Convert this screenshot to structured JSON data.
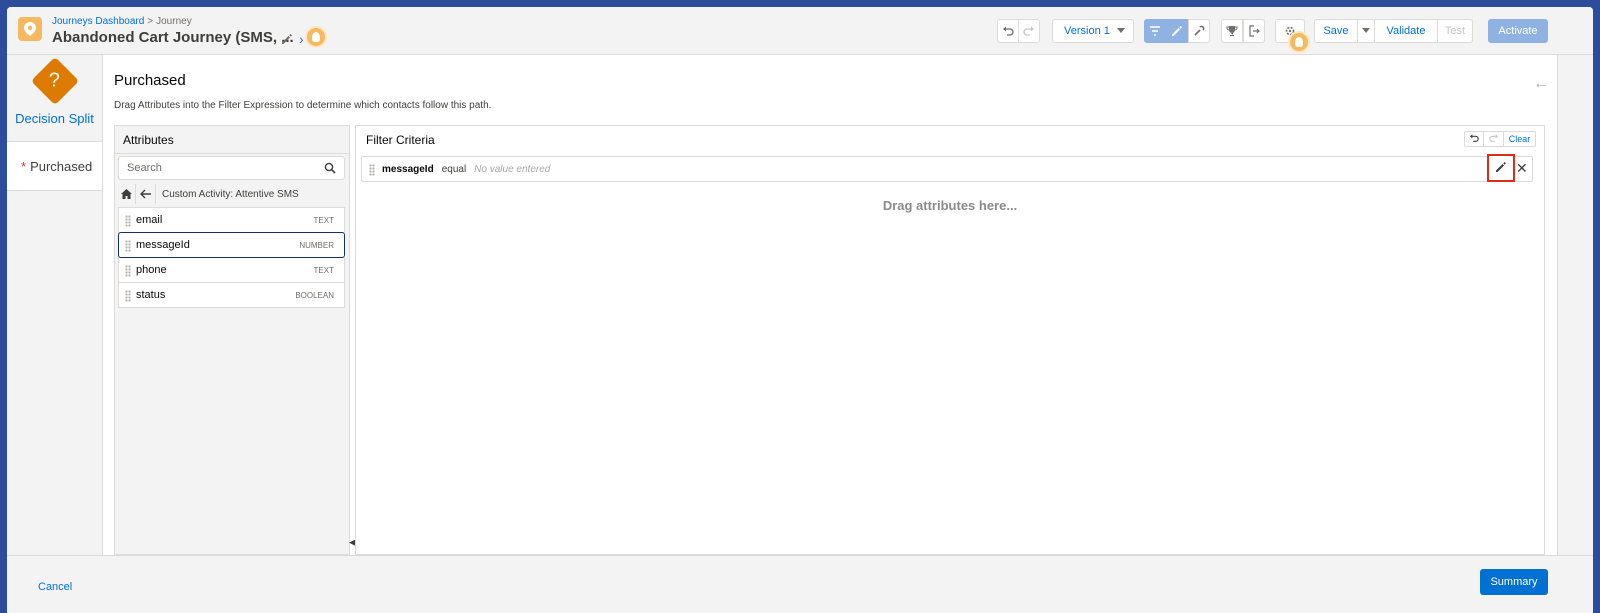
{
  "header": {
    "breadcrumb": [
      "Journeys Dashboard",
      "Journey"
    ],
    "breadcrumb_separator": ">",
    "title": "Abandoned Cart Journey (SMS, ...",
    "version_label": "Version 1",
    "save_label": "Save",
    "validate_label": "Validate",
    "test_label": "Test",
    "activate_label": "Activate"
  },
  "leftnav": {
    "activity_label": "Decision Split",
    "activity_icon_glyph": "?",
    "path_item_required_mark": "*",
    "path_item_label": "Purchased"
  },
  "main": {
    "title": "Purchased",
    "description": "Drag Attributes into the Filter Expression to determine which contacts follow this path.",
    "attributes": {
      "header": "Attributes",
      "search_placeholder": "Search",
      "path_label": "Custom Activity: Attentive SMS",
      "items": [
        {
          "name": "email",
          "type": "TEXT"
        },
        {
          "name": "messageId",
          "type": "NUMBER"
        },
        {
          "name": "phone",
          "type": "TEXT"
        },
        {
          "name": "status",
          "type": "BOOLEAN"
        }
      ]
    },
    "filter": {
      "header": "Filter Criteria",
      "clear_label": "Clear",
      "criteria": {
        "field": "messageId",
        "operator": "equal",
        "value_placeholder": "No value entered"
      },
      "drag_hint": "Drag attributes here..."
    }
  },
  "footer": {
    "cancel_label": "Cancel",
    "summary_label": "Summary"
  },
  "colors": {
    "brand": "#0070d2",
    "activity_orange": "#dd7a01",
    "highlight_red": "#e02b16",
    "background_blue": "#2d4c9c"
  }
}
